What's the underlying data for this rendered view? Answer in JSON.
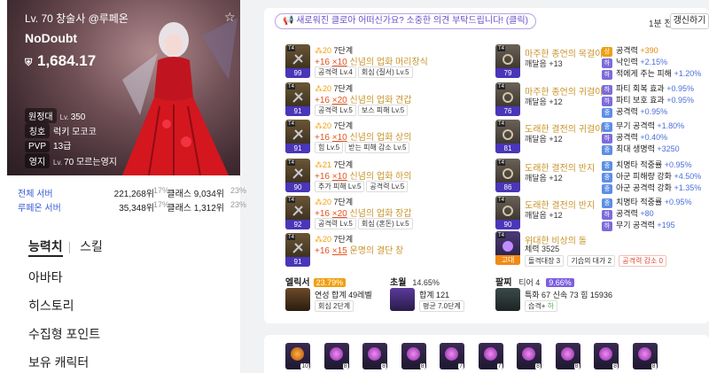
{
  "profile": {
    "level_class": "Lv. 70 창술사 @루페온",
    "name": "NoDoubt",
    "combat_power": "1,684.17",
    "expedition": {
      "label": "원정대",
      "prefix": "Lv.",
      "value": "350"
    },
    "title": {
      "label": "칭호",
      "value": "럭키 모코코"
    },
    "pvp": {
      "label": "PVP",
      "value": "13급"
    },
    "estate": {
      "label": "영지",
      "prefix": "Lv.",
      "value": "70 모르는영지"
    }
  },
  "rankings": [
    {
      "label": "전체 서버",
      "rank": "221,268위",
      "pct": "17%",
      "class_rank": "클래스 9,034위",
      "class_pct": "23%"
    },
    {
      "label": "루페온 서버",
      "rank": "35,348위",
      "pct": "17%",
      "class_rank": "클래스 1,312위",
      "class_pct": "23%"
    }
  ],
  "menu": {
    "tabs": [
      "능력치",
      "스킬"
    ],
    "items": [
      "아바타",
      "히스토리",
      "수집형 포인트",
      "보유 캐릭터"
    ]
  },
  "header": {
    "banner": "새로워진 클로아 어떠신가요? 소중한 의견 부탁드립니다! (클릭)",
    "updated": "1분 전",
    "refresh": "갱신하기"
  },
  "equipment": [
    {
      "tier": "T4",
      "level": "99",
      "quality": "20",
      "stage": "7단계",
      "plus": "+16",
      "mult": "×10",
      "name": "신념의 업화 머리장식",
      "pills": [
        "공격력 Lv.4",
        "회심 (질서) Lv.5"
      ]
    },
    {
      "tier": "T4",
      "level": "91",
      "quality": "20",
      "stage": "7단계",
      "plus": "+16",
      "mult": "×20",
      "name": "신념의 업화 견갑",
      "pills": [
        "공격력 Lv.5",
        "보스 피해 Lv.5"
      ]
    },
    {
      "tier": "T4",
      "level": "91",
      "quality": "20",
      "stage": "7단계",
      "plus": "+16",
      "mult": "×10",
      "name": "신념의 업화 상의",
      "pills": [
        "힘 Lv.5",
        "받는 피해 감소 Lv.5"
      ]
    },
    {
      "tier": "T4",
      "level": "90",
      "quality": "21",
      "stage": "7단계",
      "plus": "+16",
      "mult": "×10",
      "name": "신념의 업화 하의",
      "pills": [
        "추가 피해 Lv.5",
        "공격력 Lv.5"
      ]
    },
    {
      "tier": "T4",
      "level": "92",
      "quality": "20",
      "stage": "7단계",
      "plus": "+16",
      "mult": "×20",
      "name": "신념의 업화 장갑",
      "pills": [
        "공격력 Lv.5",
        "회심 (혼돈) Lv.5"
      ]
    },
    {
      "tier": "T4",
      "level": "91",
      "quality": "20",
      "stage": "7단계",
      "plus": "+16",
      "mult": "×15",
      "name": "운명의 결단 창",
      "pills": []
    }
  ],
  "accessories": [
    {
      "tier": "T4",
      "level": "79",
      "name": "마주한 종언의 목걸이",
      "sub": "깨달음 +13",
      "stats": [
        [
          "상",
          "공격력 ",
          "+390",
          "o"
        ],
        [
          "하",
          "낙인력 ",
          "+2.15%",
          ""
        ],
        [
          "하",
          "적에게 주는 피해 ",
          "+1.20%",
          ""
        ]
      ]
    },
    {
      "tier": "T4",
      "level": "76",
      "name": "마주한 종언의 귀걸이",
      "sub": "깨달음 +12",
      "stats": [
        [
          "하",
          "파티 회복 효과 ",
          "+0.95%",
          ""
        ],
        [
          "하",
          "파티 보호 효과 ",
          "+0.95%",
          ""
        ],
        [
          "중",
          "공격력 ",
          "+0.95%",
          ""
        ]
      ]
    },
    {
      "tier": "T4",
      "level": "81",
      "name": "도래한 결전의 귀걸이",
      "sub": "깨달음 +12",
      "stats": [
        [
          "중",
          "무기 공격력 ",
          "+1.80%",
          ""
        ],
        [
          "하",
          "공격력 ",
          "+0.40%",
          ""
        ],
        [
          "중",
          "최대 생명력 ",
          "+3250",
          ""
        ]
      ]
    },
    {
      "tier": "T4",
      "level": "86",
      "name": "도래한 결전의 반지",
      "sub": "깨달음 +12",
      "stats": [
        [
          "중",
          "치명타 적중률 ",
          "+0.95%",
          ""
        ],
        [
          "중",
          "아군 피해량 강화 ",
          "+4.50%",
          ""
        ],
        [
          "중",
          "아군 공격력 강화 ",
          "+1.35%",
          ""
        ]
      ]
    },
    {
      "tier": "T4",
      "level": "90",
      "name": "도래한 결전의 반지",
      "sub": "깨달음 +12",
      "stats": [
        [
          "중",
          "치명타 적중률 ",
          "+0.95%",
          ""
        ],
        [
          "하",
          "공격력 ",
          "+80",
          ""
        ],
        [
          "하",
          "무기 공격력 ",
          "+195",
          ""
        ]
      ]
    }
  ],
  "stone": {
    "tier": "T4",
    "level": "고대",
    "name": "위대한 비상의 돌",
    "hp": "체력 3525",
    "pills": [
      "돌격대장 3",
      "기습의 대가 2",
      "공격력 감소 0"
    ]
  },
  "elixir": {
    "label": "엘릭서",
    "badge": "23.79%",
    "line1": "연성 합계 49레벨",
    "line2": "회심 2단계"
  },
  "transcend": {
    "label": "초월",
    "badge": "14.65%",
    "line1": "합계 121",
    "line2": "평균 7.0단계"
  },
  "bracelet": {
    "label": "팔찌",
    "tier": "티어 4",
    "badge": "9.66%",
    "line1": "특화 67  신속 73  힘 15936",
    "line2_label": "습격+ ",
    "line2_grade": "하"
  },
  "gems": [
    "10",
    "8",
    "8",
    "8",
    "7",
    "7",
    "8",
    "8",
    "8",
    "8"
  ],
  "colors": {
    "accent": "#5b3fd0",
    "orange": "#f0a010",
    "link": "#3b5bd6"
  }
}
